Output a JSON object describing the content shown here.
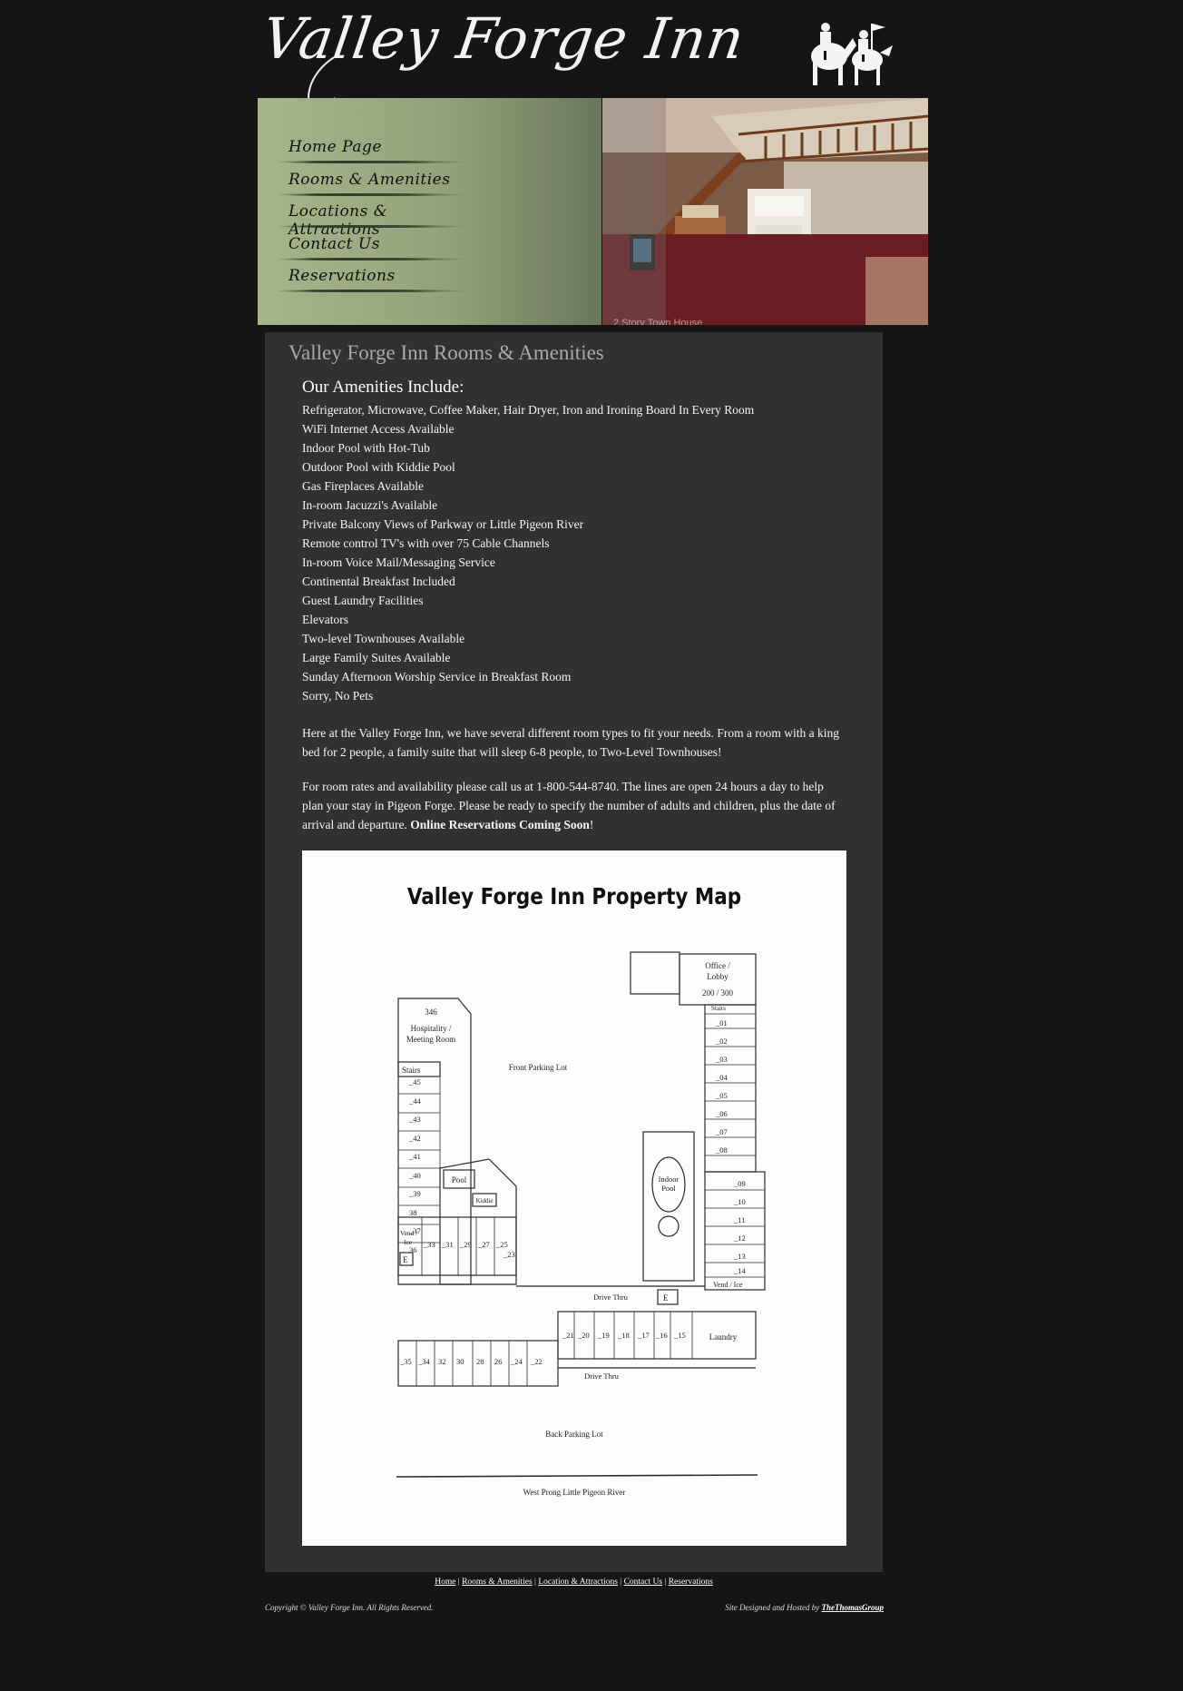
{
  "header": {
    "logo_text": "Valley Forge Inn"
  },
  "nav": {
    "items": [
      {
        "label": "Home Page"
      },
      {
        "label": "Rooms & Amenities"
      },
      {
        "label": "Locations & Attractions"
      },
      {
        "label": "Contact Us"
      },
      {
        "label": "Reservations"
      }
    ]
  },
  "banner": {
    "photo_caption": "2 Story Town House"
  },
  "main": {
    "title": "Valley Forge Inn Rooms & Amenities",
    "amenities_heading": "Our Amenities Include:",
    "amenities": [
      "Refrigerator, Microwave, Coffee Maker, Hair Dryer, Iron and Ironing Board In Every Room",
      "WiFi Internet Access Available",
      "Indoor Pool with Hot-Tub",
      "Outdoor Pool with Kiddie Pool",
      "Gas Fireplaces Available",
      "In-room Jacuzzi's Available",
      "Private Balcony Views of Parkway or Little Pigeon River",
      "Remote control TV's with over 75 Cable Channels",
      "In-room Voice Mail/Messaging Service",
      "Continental Breakfast Included",
      "Guest Laundry Facilities",
      "Elevators",
      "Two-level Townhouses Available",
      "Large Family Suites Available",
      "Sunday Afternoon Worship Service in Breakfast Room",
      "Sorry, No Pets"
    ],
    "para1": "Here at the Valley Forge Inn, we have several different room types to fit your needs. From a room with a king bed for 2 people, a family suite that will sleep 6-8 people, to Two-Level Townhouses!",
    "para2_text": "For room rates and availability please call us at 1-800-544-8740. The lines are open 24 hours a day to help plan your stay in Pigeon Forge. Please be ready to specify the number of adults and children, plus the date of arrival and departure. ",
    "para2_bold": "Online Reservations Coming Soon",
    "para2_end": "!"
  },
  "map": {
    "title": "Valley Forge Inn Property Map",
    "labels": {
      "office": "Office /",
      "lobby": "Lobby",
      "office_rooms": "200 / 300",
      "stairs_right": "Stairs",
      "room_346": "346",
      "hospitality": "Hospitality /",
      "meeting_room": "Meeting Room",
      "stairs_left": "Stairs",
      "front_parking": "Front  Parking  Lot",
      "pool": "Pool",
      "kiddie": "Kiddie",
      "indoor": "Indoor",
      "indoor_pool": "Pool",
      "vend_left1": "Vend /",
      "vend_left2": "Ice",
      "vend_right": "Vend / Ice",
      "elevator": "E",
      "drive_thru": "Drive Thru",
      "laundry": "Laundry",
      "back_parking": "Back  Parking  Lot",
      "river": "West   Prong   Little   Pigeon   River"
    },
    "right_rooms": [
      "_01",
      "_02",
      "_03",
      "_04",
      "_05",
      "_06",
      "_07",
      "_08"
    ],
    "right_lower_rooms": [
      "_09",
      "_10",
      "_11",
      "_12",
      "_13",
      "_14"
    ],
    "left_rooms": [
      "_45",
      "_44",
      "_43",
      "_42",
      "_41",
      "_40",
      "_39",
      "38",
      "_37",
      "36"
    ],
    "upper_row_rooms": [
      "_33",
      "_31",
      "_29",
      "_27",
      "_25",
      "_23"
    ],
    "middle_row_rooms": [
      "_21",
      "_20",
      "_19",
      "_18",
      "_17",
      "_16",
      "_15"
    ],
    "lower_row_rooms": [
      "_35",
      "_34",
      "32",
      "30",
      "28",
      "26",
      "_24",
      "_22"
    ]
  },
  "footer": {
    "links": [
      "Home",
      "Rooms & Amenities",
      "Location & Attractions",
      "Contact Us",
      "Reservations"
    ],
    "separator": " | ",
    "copyright": "Copyright © Valley Forge Inn. All Rights Reserved.",
    "credit_prefix": "Site Designed and Hosted by ",
    "credit_link": "TheThomasGroup"
  }
}
